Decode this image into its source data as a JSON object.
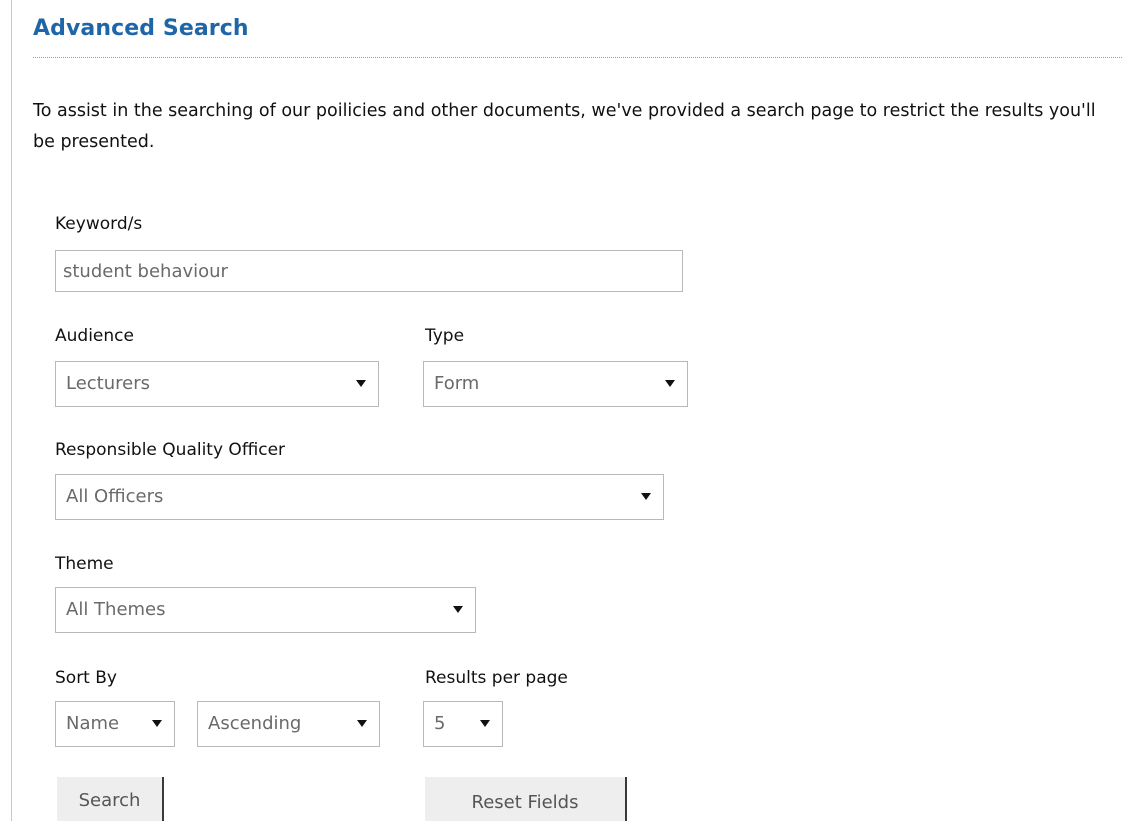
{
  "page": {
    "title": "Advanced Search",
    "intro": "To assist in the searching of our poilicies and other documents, we've provided a search page to restrict the results you'll be presented."
  },
  "form": {
    "keyword": {
      "label": "Keyword/s",
      "value": "student behaviour"
    },
    "audience": {
      "label": "Audience",
      "value": "Lecturers"
    },
    "type": {
      "label": "Type",
      "value": "Form"
    },
    "officer": {
      "label": "Responsible Quality Officer",
      "value": "All Officers"
    },
    "theme": {
      "label": "Theme",
      "value": "All Themes"
    },
    "sort": {
      "label": "Sort By",
      "field": "Name",
      "order": "Ascending"
    },
    "results": {
      "label": "Results per page",
      "value": "5"
    },
    "buttons": {
      "search": "Search",
      "reset": "Reset Fields"
    }
  }
}
